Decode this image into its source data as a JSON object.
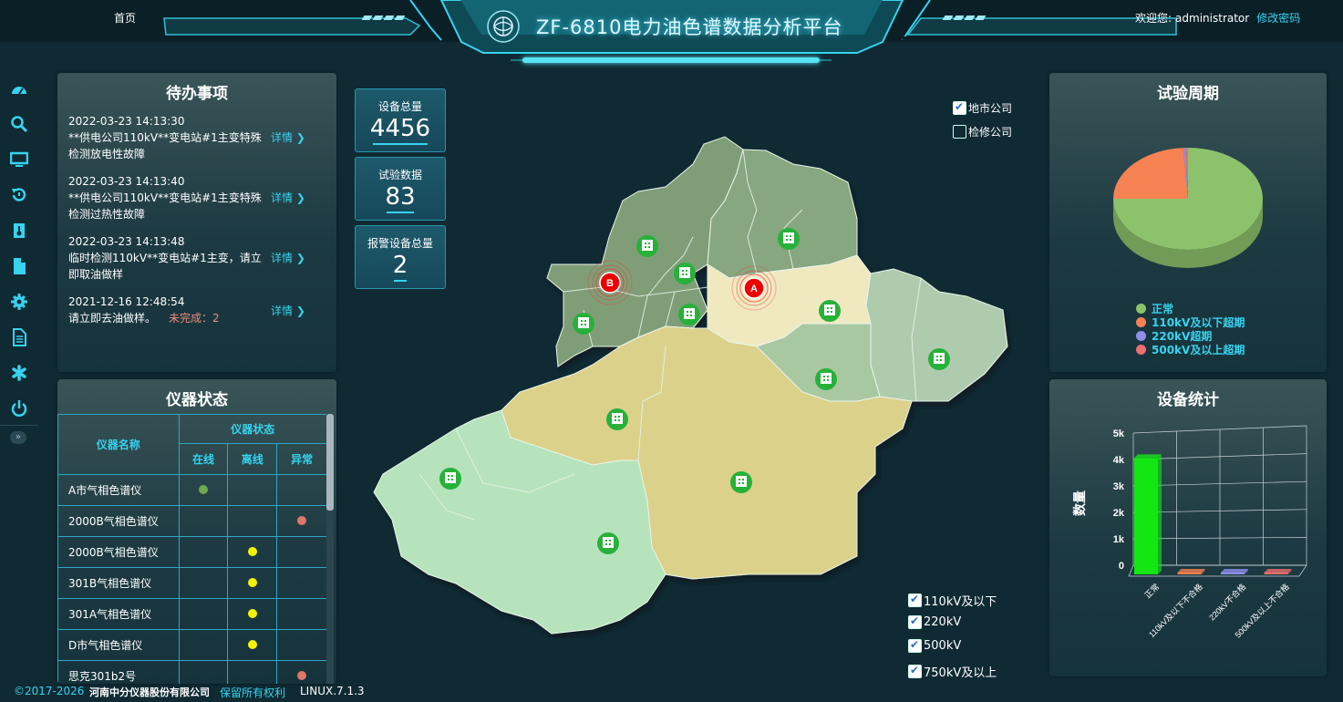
{
  "header": {
    "home_label": "首页",
    "title": "ZF-6810电力油色谱数据分析平台",
    "welcome_label": "欢迎您:",
    "username": "administrator",
    "change_password_label": "修改密码"
  },
  "sidebar": {
    "items": [
      {
        "icon": "dashboard-icon"
      },
      {
        "icon": "search-icon"
      },
      {
        "icon": "monitor-icon"
      },
      {
        "icon": "history-icon"
      },
      {
        "icon": "thermometer-icon"
      },
      {
        "icon": "document-icon"
      },
      {
        "icon": "gear-icon"
      },
      {
        "icon": "report-icon"
      },
      {
        "icon": "asterisk-icon"
      },
      {
        "icon": "power-icon"
      }
    ],
    "toggle_label": "»"
  },
  "todo": {
    "title": "待办事项",
    "detail_label": "详情",
    "items": [
      {
        "date": "2022-03-23 14:13:30",
        "text": "**供电公司110kV**变电站#1主变特殊检测放电性故障"
      },
      {
        "date": "2022-03-23 14:13:40",
        "text": "**供电公司110kV**变电站#1主变特殊检测过热性故障"
      },
      {
        "date": "2022-03-23 14:13:48",
        "text": "临时检测110kV**变电站#1主变，请立即取油做样"
      },
      {
        "date": "2021-12-16 12:48:54",
        "text": "请立即去油做样。",
        "pending": "未完成：2"
      }
    ]
  },
  "instrument_status": {
    "title": "仪器状态",
    "col_name": "仪器名称",
    "col_status": "仪器状态",
    "col_online": "在线",
    "col_offline": "离线",
    "col_abnormal": "异常",
    "rows": [
      {
        "name": "A市气相色谱仪",
        "state": "online"
      },
      {
        "name": "2000B气相色谱仪",
        "state": "abnormal"
      },
      {
        "name": "2000B气相色谱仪",
        "state": "offline"
      },
      {
        "name": "301B气相色谱仪",
        "state": "offline"
      },
      {
        "name": "301A气相色谱仪",
        "state": "offline"
      },
      {
        "name": "D市气相色谱仪",
        "state": "offline"
      },
      {
        "name": "思克301b2号",
        "state": "abnormal"
      }
    ],
    "colors": {
      "online": "#6fa94c",
      "offline": "#f3f300",
      "abnormal": "#e0776c"
    }
  },
  "stats": {
    "device_total_label": "设备总量",
    "device_total": "4456",
    "test_data_label": "试验数据",
    "test_data": "83",
    "alarm_total_label": "报警设备总量",
    "alarm_total": "2"
  },
  "map": {
    "filters": [
      {
        "label": "地市公司",
        "checked": true
      },
      {
        "label": "检修公司",
        "checked": false
      }
    ],
    "voltage_filters": [
      {
        "label": "110kV及以下",
        "checked": true
      },
      {
        "label": "220kV",
        "checked": true
      },
      {
        "label": "500kV",
        "checked": true
      },
      {
        "label": "750kV及以上",
        "checked": true
      }
    ],
    "alarm_markers": [
      "A",
      "B"
    ]
  },
  "cycle": {
    "title": "试验周期",
    "legend": [
      {
        "label": "正常",
        "color": "#8dc26c"
      },
      {
        "label": "110kV及以下超期",
        "color": "#f68253"
      },
      {
        "label": "220kV超期",
        "color": "#8f8fe8"
      },
      {
        "label": "500kV及以上超期",
        "color": "#ec6e6e"
      }
    ],
    "chart_data": {
      "type": "pie",
      "labels": [
        "正常",
        "110kV及以下超期",
        "220kV超期",
        "500kV及以上超期"
      ],
      "values": [
        75,
        24,
        0.5,
        0.5
      ],
      "title": "试验周期"
    }
  },
  "device_stats": {
    "title": "设备统计",
    "chart_data": {
      "type": "bar",
      "categories": [
        "正常",
        "110kV及以下不合格",
        "220kV不合格",
        "500kV及以上不合格"
      ],
      "values": [
        4400,
        20,
        20,
        20
      ],
      "colors": [
        "#13e613",
        "#f68253",
        "#8f8fe8",
        "#ec6e6e"
      ],
      "ylabel": "数量",
      "ylim": [
        0,
        5000
      ],
      "yticks": [
        "0",
        "1k",
        "2k",
        "3k",
        "4k",
        "5k"
      ]
    }
  },
  "footer": {
    "copyright": "©2017-2026",
    "company": "河南中分仪器股份有限公司",
    "rights": "保留所有权利",
    "version": "LINUX.7.1.3"
  }
}
